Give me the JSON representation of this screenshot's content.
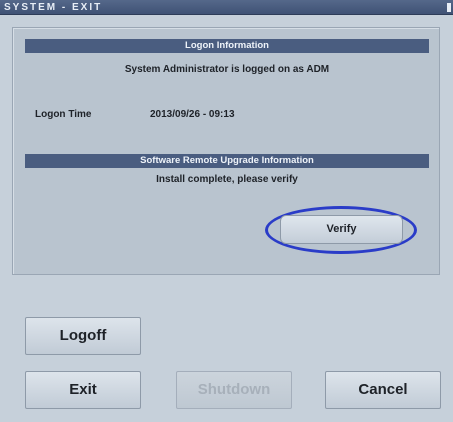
{
  "window": {
    "title": "SYSTEM - EXIT"
  },
  "logon": {
    "header": "Logon Information",
    "status": "System Administrator is logged on as ADM",
    "time_label": "Logon Time",
    "time_value": "2013/09/26 - 09:13"
  },
  "upgrade": {
    "header": "Software Remote Upgrade Information",
    "message": "Install complete, please verify",
    "verify_label": "Verify",
    "highlight_color": "#2a3cc8"
  },
  "buttons": {
    "logoff": "Logoff",
    "exit": "Exit",
    "shutdown": "Shutdown",
    "cancel": "Cancel"
  }
}
